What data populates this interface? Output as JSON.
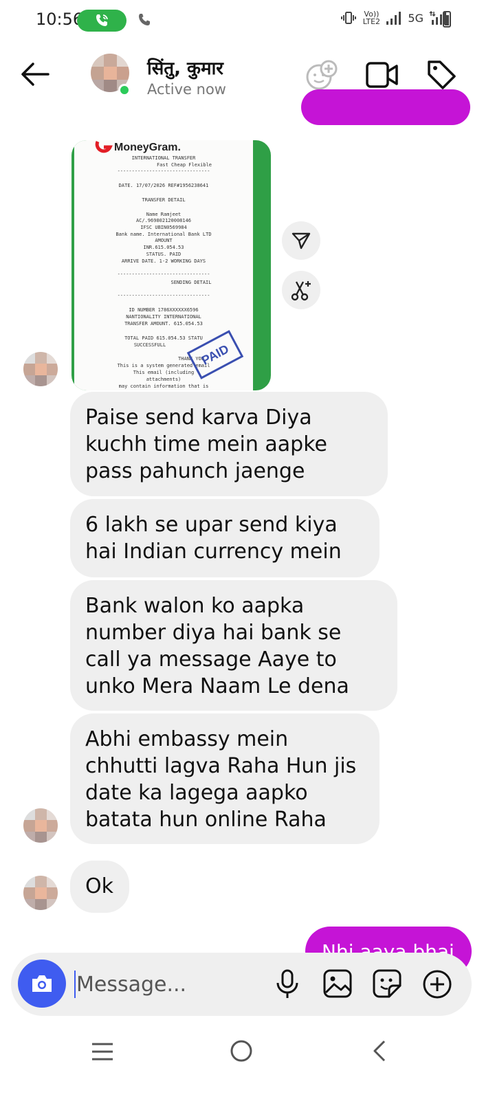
{
  "status_bar": {
    "time": "10:56",
    "network_small": "Vo))\nLTE2",
    "network_type": "5G"
  },
  "header": {
    "contact_name": "सिंतु, कुमार",
    "contact_status": "Active now"
  },
  "receipt": {
    "brand": "MoneyGram.",
    "lines": [
      "INTERNATIONAL TRANSFER",
      "Fast Cheap Flexible",
      "--------------------------------",
      "DATE. 17/07/2026  REF#1956238641",
      "TRANSFER DETAIL",
      "Name Ramjeet",
      "AC/.969802120008146",
      "IFSC UBIN0569984",
      "Bank name. International Bank  LTD",
      "AMOUNT",
      "INR.615.054.53",
      "STATUS.           PAID",
      "ARRIVE DATE.  1-2 WORKING DAYS",
      "SENDING DETAIL",
      "ID NUMBER      1786XXXXXX6596",
      "NANTIONALITY      INTERNATIONAL",
      "TRANSFER AMOUNT.    615.054.53",
      "TOTAL PAID    615.054.53   STATU",
      "SUCCESSFULL",
      "THANK YOU",
      "This is a system generated email",
      "This email (including",
      "attachments)",
      "may contain information that is"
    ],
    "stamp": "PAID"
  },
  "messages": {
    "m1": "Paise send karva Diya kuchh time mein aapke pass pahunch jaenge",
    "m2": "6 lakh se upar send kiya hai Indian currency mein",
    "m3": "Bank walon ko aapka number diya hai bank se call ya message Aaye to unko Mera Naam Le dena",
    "m4": "Abhi embassy mein chhutti lagva Raha Hun jis date ka lagega aapko batata hun online Raha",
    "m5": "Ok",
    "sent_last": "Nhi aaya bhai"
  },
  "composer": {
    "placeholder": "Message..."
  },
  "colors": {
    "sent_bubble": "#c514d6",
    "received_bubble": "#efefef",
    "camera_button": "#3f5cf0",
    "online": "#2ccb5a",
    "call_pill": "#2fb24a"
  }
}
